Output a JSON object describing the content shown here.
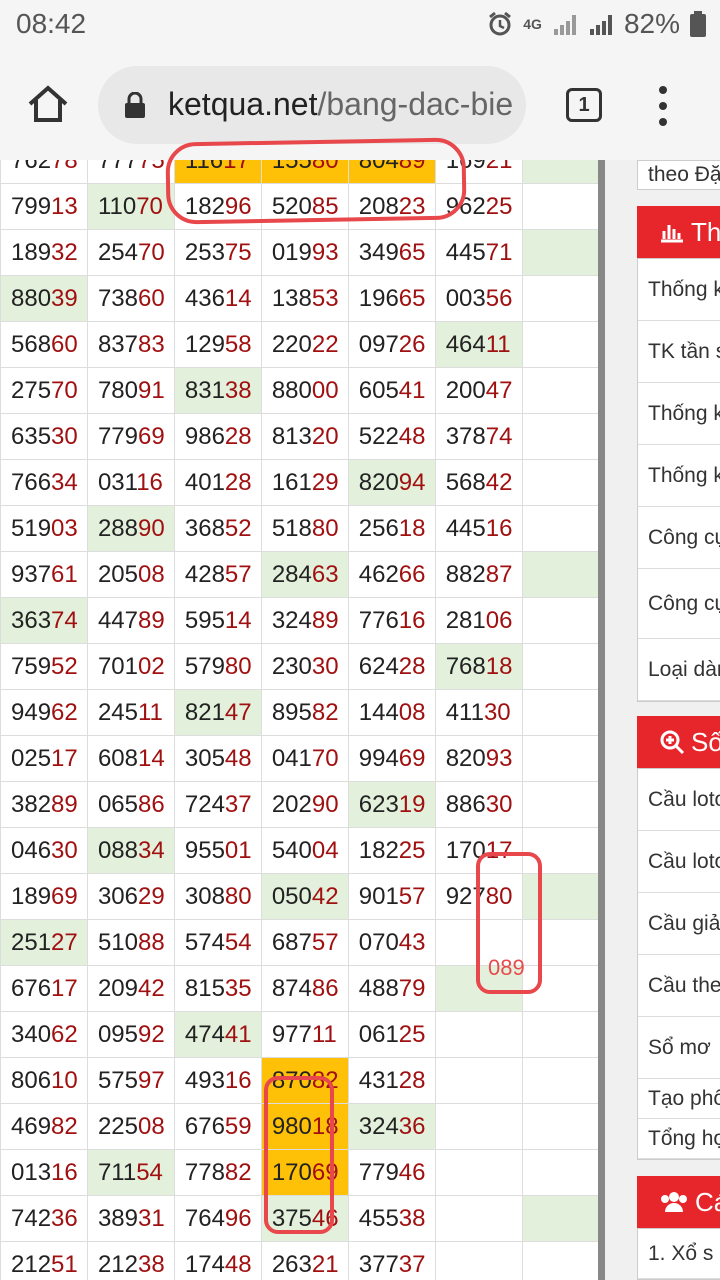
{
  "status": {
    "time": "08:42",
    "network": "4G",
    "battery": "82%"
  },
  "browser": {
    "url_host": "ketqua.net",
    "url_path": "/bang-dac-bie",
    "tab_count": "1"
  },
  "table": {
    "rows": [
      [
        "76278",
        "77775",
        "11617",
        "15580",
        "80489",
        "16921",
        ""
      ],
      [
        "79913",
        "11070",
        "18296",
        "52085",
        "20823",
        "96225",
        ""
      ],
      [
        "18932",
        "25470",
        "25375",
        "01993",
        "34965",
        "44571",
        ""
      ],
      [
        "88039",
        "73860",
        "43614",
        "13853",
        "19665",
        "00356",
        ""
      ],
      [
        "56860",
        "83783",
        "12958",
        "22022",
        "09726",
        "46411",
        ""
      ],
      [
        "27570",
        "78091",
        "83138",
        "88000",
        "60541",
        "20047",
        ""
      ],
      [
        "63530",
        "77969",
        "98628",
        "81320",
        "52248",
        "37874",
        ""
      ],
      [
        "76634",
        "03116",
        "40128",
        "16129",
        "82094",
        "56842",
        ""
      ],
      [
        "51903",
        "28890",
        "36852",
        "51880",
        "25618",
        "44516",
        ""
      ],
      [
        "93761",
        "20508",
        "42857",
        "28463",
        "46266",
        "88287",
        ""
      ],
      [
        "36374",
        "44789",
        "59514",
        "32489",
        "77616",
        "28106",
        ""
      ],
      [
        "75952",
        "70102",
        "57980",
        "23030",
        "62428",
        "76818",
        ""
      ],
      [
        "94962",
        "24511",
        "82147",
        "89582",
        "14408",
        "41130",
        ""
      ],
      [
        "02517",
        "60814",
        "30548",
        "04170",
        "99469",
        "82093",
        ""
      ],
      [
        "38289",
        "06586",
        "72437",
        "20290",
        "62319",
        "88630",
        ""
      ],
      [
        "04630",
        "08834",
        "95501",
        "54004",
        "18225",
        "17017",
        ""
      ],
      [
        "18969",
        "30629",
        "30880",
        "05042",
        "90157",
        "92780",
        ""
      ],
      [
        "25127",
        "51088",
        "57454",
        "68757",
        "07043",
        "",
        ""
      ],
      [
        "67617",
        "20942",
        "81535",
        "87486",
        "48879",
        "",
        ""
      ],
      [
        "34062",
        "09592",
        "47441",
        "97711",
        "06125",
        "",
        ""
      ],
      [
        "80610",
        "57597",
        "49316",
        "87082",
        "43128",
        "",
        ""
      ],
      [
        "46982",
        "22508",
        "67659",
        "98018",
        "32436",
        "",
        ""
      ],
      [
        "01316",
        "71154",
        "77882",
        "17069",
        "77946",
        "",
        ""
      ],
      [
        "74236",
        "38931",
        "76496",
        "37546",
        "45538",
        "",
        ""
      ],
      [
        "21251",
        "21238",
        "17448",
        "26321",
        "37737",
        "",
        ""
      ]
    ],
    "highlight_green": [
      [
        0,
        6
      ],
      [
        1,
        1
      ],
      [
        2,
        6
      ],
      [
        3,
        0
      ],
      [
        4,
        5
      ],
      [
        5,
        2
      ],
      [
        7,
        4
      ],
      [
        8,
        1
      ],
      [
        9,
        3
      ],
      [
        9,
        6
      ],
      [
        10,
        0
      ],
      [
        11,
        5
      ],
      [
        12,
        2
      ],
      [
        14,
        4
      ],
      [
        15,
        1
      ],
      [
        16,
        3
      ],
      [
        16,
        6
      ],
      [
        17,
        0
      ],
      [
        18,
        5
      ],
      [
        19,
        2
      ],
      [
        21,
        4
      ],
      [
        22,
        1
      ],
      [
        23,
        3
      ],
      [
        23,
        6
      ]
    ],
    "highlight_orange": [
      [
        0,
        2
      ],
      [
        0,
        3
      ],
      [
        0,
        4
      ],
      [
        20,
        3
      ],
      [
        21,
        3
      ],
      [
        22,
        3
      ]
    ],
    "annotation_label": "089"
  },
  "sidebar": {
    "top_text": "theo Đặ",
    "section1_title": "Th",
    "section1_items": [
      "Thống k",
      "TK tần s",
      "Thống k",
      "Thống k",
      "Công cụ",
      "Công cụ VIP",
      "Loại dàn"
    ],
    "section2_title": "Số",
    "section2_items": [
      "Cầu loto",
      "Cầu loto",
      "Cầu giả",
      "Cầu the",
      "Sổ mơ",
      "Tạo phô",
      "Tổng hợ"
    ],
    "section3_title": "Cá",
    "section3_items": [
      "1. Xổ s"
    ]
  }
}
